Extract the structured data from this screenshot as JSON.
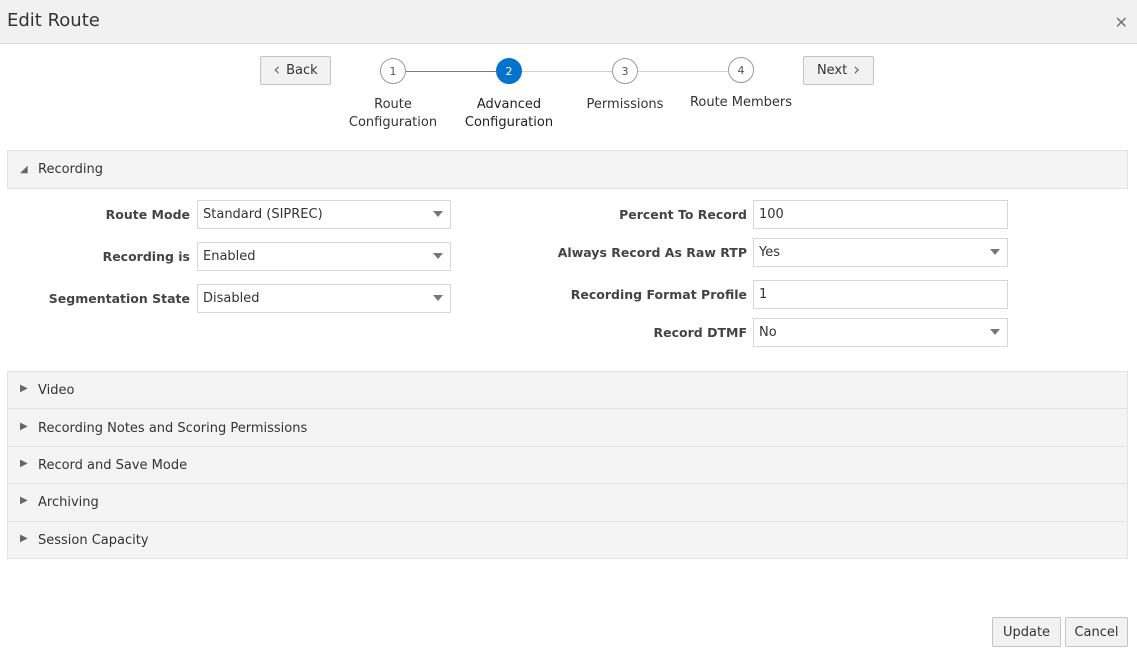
{
  "dialog": {
    "title": "Edit Route"
  },
  "train": {
    "back_label": "Back",
    "next_label": "Next",
    "steps": [
      {
        "number": "1",
        "line1": "Route",
        "line2": "Configuration"
      },
      {
        "number": "2",
        "line1": "Advanced",
        "line2": "Configuration"
      },
      {
        "number": "3",
        "line1": "Permissions",
        "line2": ""
      },
      {
        "number": "4",
        "line1": "Route Members",
        "line2": ""
      }
    ]
  },
  "recording": {
    "header": "Recording",
    "route_mode": {
      "label": "Route Mode",
      "value": "Standard (SIPREC)"
    },
    "recording_is": {
      "label": "Recording is",
      "value": "Enabled"
    },
    "segmentation_state": {
      "label": "Segmentation State",
      "value": "Disabled"
    },
    "percent_to_record": {
      "label": "Percent To Record",
      "value": "100"
    },
    "always_record_raw_rtp": {
      "label": "Always Record As Raw RTP",
      "value": "Yes"
    },
    "recording_format_profile": {
      "label": "Recording Format Profile",
      "value": "1"
    },
    "record_dtmf": {
      "label": "Record DTMF",
      "value": "No"
    }
  },
  "sections": [
    {
      "label": "Video"
    },
    {
      "label": "Recording Notes and Scoring Permissions"
    },
    {
      "label": "Record and Save Mode"
    },
    {
      "label": "Archiving"
    },
    {
      "label": "Session Capacity"
    }
  ],
  "footer": {
    "update_label": "Update",
    "cancel_label": "Cancel"
  }
}
